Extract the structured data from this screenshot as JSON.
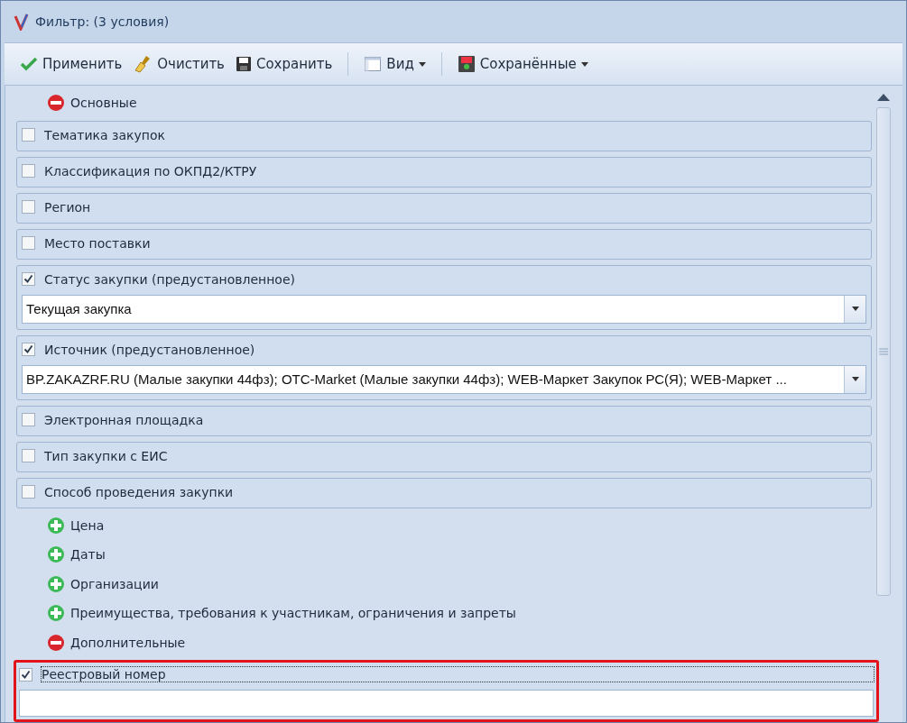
{
  "window": {
    "title": "Фильтр: (3 условия)"
  },
  "toolbar": [
    {
      "kind": "apply",
      "label": "Применить",
      "menu": false
    },
    {
      "kind": "clear",
      "label": "Очистить",
      "menu": false
    },
    {
      "kind": "save",
      "label": "Сохранить",
      "menu": false
    },
    {
      "kind": "separator"
    },
    {
      "kind": "view",
      "label": "Вид",
      "menu": true
    },
    {
      "kind": "separator"
    },
    {
      "kind": "saved",
      "label": "Сохранённые",
      "menu": true
    }
  ],
  "sections": [
    {
      "kind": "group",
      "label": "Основные",
      "expanded": true
    },
    {
      "kind": "filter",
      "label": "Тематика закупок",
      "checked": false,
      "highlighted": false
    },
    {
      "kind": "filter",
      "label": "Классификация по ОКПД2/КТРУ",
      "checked": false,
      "highlighted": false
    },
    {
      "kind": "filter",
      "label": "Регион",
      "checked": false,
      "highlighted": false
    },
    {
      "kind": "filter",
      "label": "Место поставки",
      "checked": false,
      "highlighted": false
    },
    {
      "kind": "filter",
      "label": "Статус закупки (предустановленное)",
      "checked": true,
      "highlighted": false,
      "field": {
        "kind": "dropdown",
        "value": "Текущая закупка"
      }
    },
    {
      "kind": "filter",
      "label": "Источник (предустановленное)",
      "checked": true,
      "highlighted": false,
      "field": {
        "kind": "dropdown",
        "value": "BP.ZAKAZRF.RU (Малые закупки 44фз); OTC-Market (Малые закупки 44фз); WEB-Маркет Закупок РС(Я); WEB-Маркет ..."
      }
    },
    {
      "kind": "filter",
      "label": "Электронная площадка",
      "checked": false,
      "highlighted": false
    },
    {
      "kind": "filter",
      "label": "Тип закупки с ЕИС",
      "checked": false,
      "highlighted": false
    },
    {
      "kind": "filter",
      "label": "Способ проведения закупки",
      "checked": false,
      "highlighted": false
    },
    {
      "kind": "group",
      "label": "Цена",
      "expanded": false
    },
    {
      "kind": "group",
      "label": "Даты",
      "expanded": false
    },
    {
      "kind": "group",
      "label": "Организации",
      "expanded": false
    },
    {
      "kind": "group",
      "label": "Преимущества, требования к участникам, ограничения и запреты",
      "expanded": false
    },
    {
      "kind": "group",
      "label": "Дополнительные",
      "expanded": true
    },
    {
      "kind": "filter",
      "label": "Реестровый номер",
      "checked": true,
      "highlighted": true,
      "field": {
        "kind": "text"
      }
    }
  ]
}
